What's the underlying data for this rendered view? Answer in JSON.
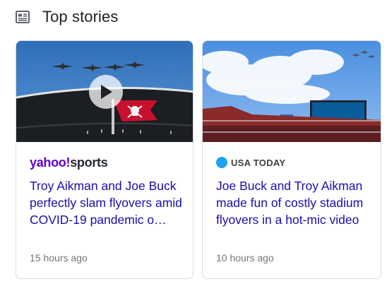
{
  "header": {
    "title": "Top stories",
    "icon": "newspaper-icon"
  },
  "cards": [
    {
      "source_brand": "yahoo",
      "source_brand_suffix": "sports",
      "source_mark": "!",
      "headline": "Troy Aikman and Joe Buck perfectly slam flyovers amid COVID-19 pandemic o…",
      "time": "15 hours ago",
      "has_video": true,
      "colors": {
        "brand": "#6001d2",
        "flag": "#c8102e"
      }
    },
    {
      "source_name": "USA TODAY",
      "headline": "Joe Buck and Troy Aikman made fun of costly stadium flyovers in a hot-mic video",
      "time": "10 hours ago",
      "has_video": false,
      "colors": {
        "brand_dot": "#1da1f2"
      }
    }
  ],
  "colors": {
    "link": "#1a0dab",
    "meta": "#70757a",
    "border": "#dadce0"
  }
}
